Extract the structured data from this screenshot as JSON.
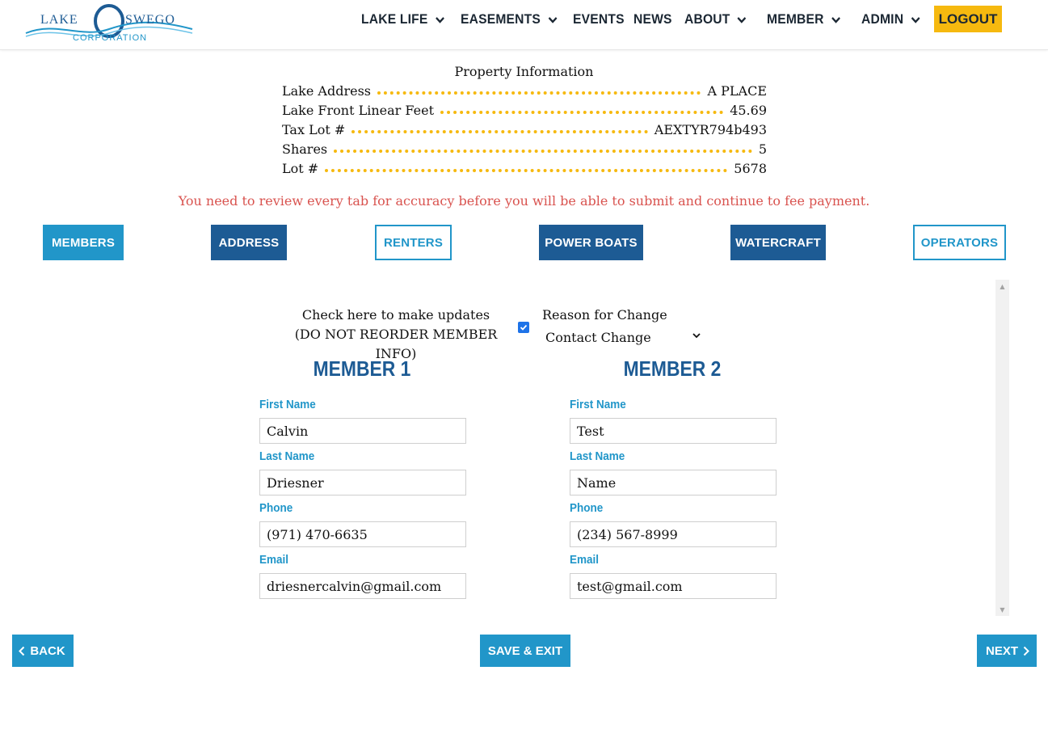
{
  "header": {
    "logo": {
      "line1_left": "LAKE",
      "line1_right": "SWEGO",
      "line2": "CORPORATION"
    },
    "nav": [
      {
        "label": "LAKE LIFE",
        "has_dropdown": true
      },
      {
        "label": "EASEMENTS",
        "has_dropdown": true
      },
      {
        "label": "EVENTS",
        "has_dropdown": false
      },
      {
        "label": "NEWS",
        "has_dropdown": false
      },
      {
        "label": "ABOUT",
        "has_dropdown": true
      },
      {
        "label": "MEMBER",
        "has_dropdown": true
      },
      {
        "label": "ADMIN",
        "has_dropdown": true
      }
    ],
    "logout_label": "LOGOUT"
  },
  "property": {
    "title": "Property Information",
    "rows": [
      {
        "label": "Lake Address",
        "value": "A PLACE"
      },
      {
        "label": "Lake Front Linear Feet",
        "value": "45.69"
      },
      {
        "label": "Tax Lot #",
        "value": "AEXTYR794b493"
      },
      {
        "label": "Shares",
        "value": "5"
      },
      {
        "label": "Lot #",
        "value": "5678"
      }
    ]
  },
  "warning": "You need to review every tab for accuracy before you will be able to submit and continue to fee payment.",
  "tabs": [
    {
      "label": "MEMBERS",
      "style": "light"
    },
    {
      "label": "ADDRESS",
      "style": "dark"
    },
    {
      "label": "RENTERS",
      "style": "outline"
    },
    {
      "label": "POWER BOATS",
      "style": "dark"
    },
    {
      "label": "WATERCRAFT",
      "style": "dark"
    },
    {
      "label": "OPERATORS",
      "style": "outline"
    }
  ],
  "update_section": {
    "check_line1": "Check here to make updates",
    "check_line2": "(DO NOT REORDER MEMBER INFO)",
    "checked": true,
    "reason_label": "Reason for Change",
    "reason_value": "Contact Change"
  },
  "members": [
    {
      "title": "MEMBER 1",
      "first_name_label": "First Name",
      "first_name": "Calvin",
      "last_name_label": "Last Name",
      "last_name": "Driesner",
      "phone_label": "Phone",
      "phone": "(971) 470-6635",
      "email_label": "Email",
      "email": "driesnercalvin@gmail.com"
    },
    {
      "title": "MEMBER 2",
      "first_name_label": "First Name",
      "first_name": "Test",
      "last_name_label": "Last Name",
      "last_name": "Name",
      "phone_label": "Phone",
      "phone": "(234) 567-8999",
      "email_label": "Email",
      "email": "test@gmail.com"
    }
  ],
  "footer": {
    "back_label": "BACK",
    "save_label": "SAVE & EXIT",
    "next_label": "NEXT"
  },
  "colors": {
    "accent": "#2196c9",
    "dark_accent": "#1d5b94",
    "logout": "#f6b90f",
    "warning": "#d9534f"
  }
}
